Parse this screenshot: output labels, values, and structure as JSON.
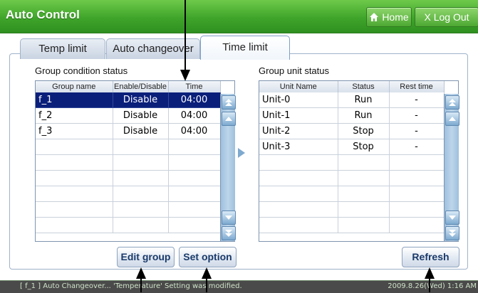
{
  "app": {
    "title": "Auto Control"
  },
  "header": {
    "home_label": "Home",
    "logout_label": "X Log Out"
  },
  "tabs": [
    {
      "label": "Temp limit",
      "active": false
    },
    {
      "label": "Auto changeover",
      "active": false
    },
    {
      "label": "Time limit",
      "active": true
    }
  ],
  "left_panel": {
    "title": "Group condition status",
    "columns": [
      "Group name",
      "Enable/Disable",
      "Time"
    ],
    "rows": [
      {
        "name": "f_1",
        "state": "Disable",
        "time": "04:00",
        "selected": true
      },
      {
        "name": "f_2",
        "state": "Disable",
        "time": "04:00",
        "selected": false
      },
      {
        "name": "f_3",
        "state": "Disable",
        "time": "04:00",
        "selected": false
      }
    ],
    "empty_rows": 6
  },
  "right_panel": {
    "title": "Group unit status",
    "columns": [
      "Unit Name",
      "Status",
      "Rest time"
    ],
    "rows": [
      {
        "name": "Unit-0",
        "status": "Run",
        "rest": "-"
      },
      {
        "name": "Unit-1",
        "status": "Run",
        "rest": "-"
      },
      {
        "name": "Unit-2",
        "status": "Stop",
        "rest": "-"
      },
      {
        "name": "Unit-3",
        "status": "Stop",
        "rest": "-"
      }
    ],
    "empty_rows": 5
  },
  "buttons": {
    "edit_group": "Edit group",
    "set_option": "Set option",
    "refresh": "Refresh"
  },
  "statusbar": {
    "message": "[ f_1 ] Auto Changeover... 'Temperature' Setting was modified.",
    "datetime": "2009.8.26(Wed)  1:16 AM"
  },
  "colors": {
    "title_green": "#3fa52a",
    "selected_row": "#0a1f7a",
    "scrollbar": "#9fc0dd"
  },
  "icons": [
    "home-icon",
    "scroll-top-icon",
    "scroll-up-icon",
    "scroll-down-icon",
    "scroll-bottom-icon",
    "right-arrow-icon"
  ]
}
